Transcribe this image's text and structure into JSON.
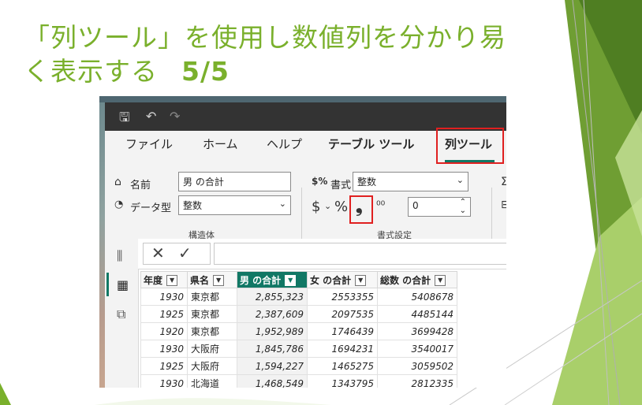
{
  "slide": {
    "title_line1": "「列ツール」を使用し数値列を分かり易",
    "title_line2": "く表示する",
    "page_indicator": "5/5",
    "accent_color": "#7ab02c"
  },
  "app": {
    "tabs": [
      "ファイル",
      "ホーム",
      "ヘルプ",
      "テーブル ツール",
      "列ツール"
    ],
    "active_tab": "列ツール",
    "accent_color": "#117865",
    "highlight_color": "#e02020"
  },
  "ribbon": {
    "name_label": "名前",
    "name_value": "男 の合計",
    "datatype_label": "データ型",
    "datatype_value": "整数",
    "group_structure": "構造体",
    "format_label": "書式",
    "format_value": "整数",
    "currency_symbol": "$",
    "percent_symbol": "%",
    "comma_symbol": "❟",
    "decimals_symbol": "⁰⁰",
    "decimal_places": "0",
    "group_format": "書式設定"
  },
  "formula_bar": {
    "cancel": "✕",
    "confirm": "✓"
  },
  "table": {
    "headers": [
      "年度",
      "県名",
      "男 の合計",
      "女 の合計",
      "総数 の合計"
    ],
    "rows": [
      [
        "1930",
        "東京都",
        "2,855,323",
        "2553355",
        "5408678"
      ],
      [
        "1925",
        "東京都",
        "2,387,609",
        "2097535",
        "4485144"
      ],
      [
        "1920",
        "東京都",
        "1,952,989",
        "1746439",
        "3699428"
      ],
      [
        "1930",
        "大阪府",
        "1,845,786",
        "1694231",
        "3540017"
      ],
      [
        "1925",
        "大阪府",
        "1,594,227",
        "1465275",
        "3059502"
      ],
      [
        "1930",
        "北海道",
        "1,468,549",
        "1343795",
        "2812335"
      ]
    ]
  }
}
